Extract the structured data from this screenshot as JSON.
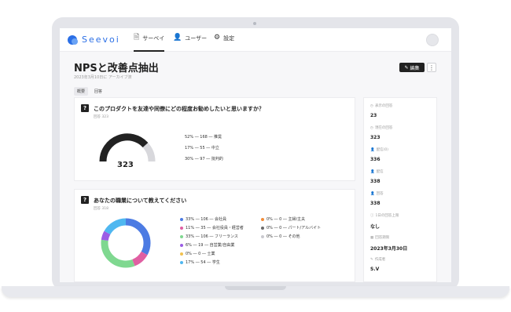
{
  "app": {
    "name": "Seevoi"
  },
  "nav": {
    "survey": "サーベイ",
    "users": "ユーザー",
    "settings": "設定"
  },
  "page": {
    "title": "NPSと改善点抽出",
    "subtitle": "2023年3月10日に アーカイブ済",
    "edit_label": "編集",
    "more_label": "⋮"
  },
  "tabs": [
    "概要",
    "回答"
  ],
  "questions": [
    {
      "number": "?",
      "title": "このプロダクトを友達や同僚にどの程度お勧めしたいと思いますか？",
      "count_label": "回答 323",
      "gauge_value": "323",
      "stats": [
        "52% ― 168 ― 推奨",
        "17% ― 55 ― 中立",
        "30% ― 97 ― 批判的"
      ]
    },
    {
      "number": "?",
      "title": "あなたの職業について教えてください",
      "count_label": "回答 318",
      "legend": [
        {
          "label": "33% ― 106 ― 会社員",
          "color": "#4c7be3"
        },
        {
          "label": "11% ― 35 ― 会社役員・経営者",
          "color": "#e05fa2"
        },
        {
          "label": "33% ― 106 ― フリーランス",
          "color": "#7fd890"
        },
        {
          "label": "6% ― 19 ― 自営業/自由業",
          "color": "#9b5de5"
        },
        {
          "label": "0% ― 0 ― 士業",
          "color": "#f2c14e"
        },
        {
          "label": "17% ― 54 ― 学生",
          "color": "#4fb7f0"
        },
        {
          "label": "0% ― 0 ― 主婦/主夫",
          "color": "#f28c38"
        },
        {
          "label": "0% ― 0 ― パート/アルバイト",
          "color": "#6b6b6b"
        },
        {
          "label": "0% ― 0 ― その他",
          "color": "#c9c9cf"
        }
      ],
      "donut": [
        33,
        11,
        33,
        6,
        0,
        17
      ]
    }
  ],
  "sidebar": [
    {
      "label": "表示の回答",
      "value": "23",
      "icon": "clock-icon"
    },
    {
      "label": "現在の回答",
      "value": "323",
      "icon": "clock-icon"
    },
    {
      "label": "配信(0)",
      "value": "336",
      "icon": "user-icon"
    },
    {
      "label": "配信",
      "value": "338",
      "icon": "user-icon"
    },
    {
      "label": "回答",
      "value": "338",
      "icon": "user-icon"
    },
    {
      "label": "1日の回答上限",
      "value": "なし",
      "icon": "info-icon"
    },
    {
      "label": "回答期限",
      "value": "2023年3月30日",
      "icon": "calendar-icon"
    },
    {
      "label": "作成者",
      "value": "S.V",
      "icon": "pencil-icon"
    }
  ],
  "colors": {
    "accent": "#2b6fe6",
    "gauge_dark": "#222222",
    "gauge_light": "#d8d8dc"
  }
}
